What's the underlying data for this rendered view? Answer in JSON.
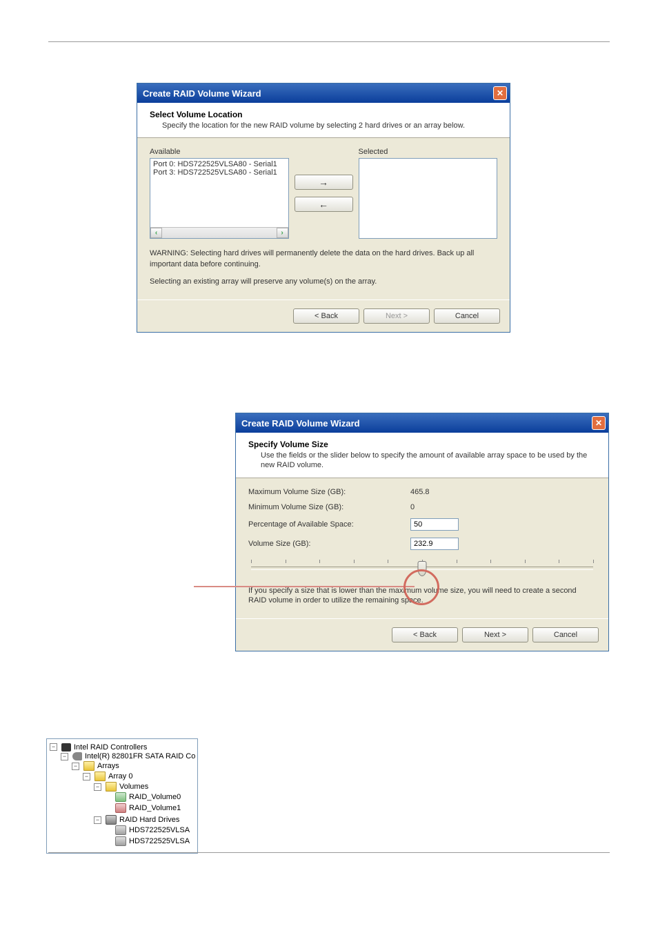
{
  "dialog1": {
    "title": "Create RAID Volume Wizard",
    "header_title": "Select Volume Location",
    "header_desc": "Specify the location for the new RAID volume by selecting 2 hard drives or an array below.",
    "available_label": "Available",
    "selected_label": "Selected",
    "available_items": [
      "Port 0: HDS722525VLSA80 - Serial1",
      "Port 3: HDS722525VLSA80 - Serial1"
    ],
    "warning": "WARNING: Selecting hard drives will permanently delete the data on the hard drives. Back up all important data before continuing.",
    "preserve_note": "Selecting an existing array will preserve any volume(s) on the array.",
    "back": "< Back",
    "next": "Next >",
    "cancel": "Cancel"
  },
  "dialog2": {
    "title": "Create RAID Volume Wizard",
    "header_title": "Specify Volume Size",
    "header_desc": "Use the fields or the slider below to specify the amount of available array space to be used by the new RAID volume.",
    "max_label": "Maximum Volume Size (GB):",
    "max_value": "465.8",
    "min_label": "Minimum Volume Size (GB):",
    "min_value": "0",
    "pct_label": "Percentage of Available Space:",
    "pct_value": "50",
    "size_label": "Volume Size (GB):",
    "size_value": "232.9",
    "slider_percent": 50,
    "note": "If you specify a size that is lower than the maximum volume size, you will need to create a second RAID volume in order to utilize the remaining space.",
    "back": "< Back",
    "next": "Next >",
    "cancel": "Cancel"
  },
  "tree": {
    "root": "Intel RAID Controllers",
    "controller": "Intel(R) 82801FR SATA RAID Co",
    "arrays": "Arrays",
    "array0": "Array 0",
    "volumes": "Volumes",
    "vol0": "RAID_Volume0",
    "vol1": "RAID_Volume1",
    "hdd_group": "RAID Hard Drives",
    "hdd0": "HDS722525VLSA",
    "hdd1": "HDS722525VLSA"
  }
}
